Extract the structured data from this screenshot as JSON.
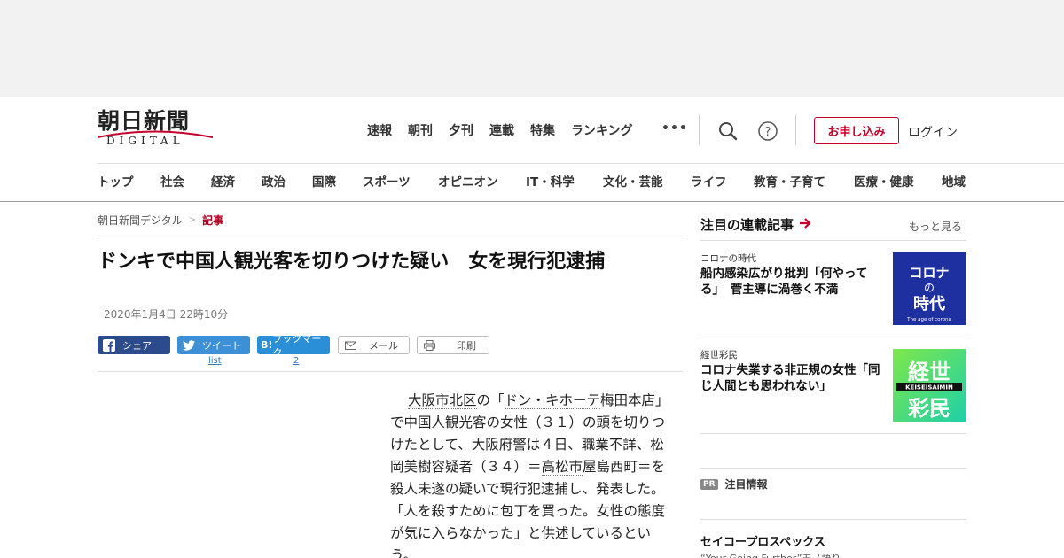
{
  "header": {
    "logo_main": "朝日新聞",
    "logo_sub": "DIGITAL",
    "top_nav": [
      "速報",
      "朝刊",
      "夕刊",
      "連載",
      "特集",
      "ランキング"
    ],
    "more": "•••",
    "subscribe": "お申し込み",
    "login": "ログイン"
  },
  "category_nav": [
    "トップ",
    "社会",
    "経済",
    "政治",
    "国際",
    "スポーツ",
    "オピニオン",
    "IT・科学",
    "文化・芸能",
    "ライフ",
    "教育・子育て",
    "医療・健康",
    "地域"
  ],
  "breadcrumb": {
    "root": "朝日新聞デジタル",
    "sep": ">",
    "current": "記事"
  },
  "article": {
    "headline": "ドンキで中国人観光客を切りつけた疑い　女を現行犯逮捕",
    "date": "2020年1月4日 22時10分",
    "share": {
      "facebook": "シェア",
      "twitter": "ツイート",
      "hatena_icon": "B!",
      "hatena": "ブックマーク",
      "mail": "メール",
      "print": "印刷",
      "twitter_count": "list",
      "hatena_count": "2"
    },
    "body": {
      "p1": "大阪市北区",
      "p2": "の「",
      "p3": "ドン・キホーテ",
      "p4": "梅田本店」で中国人観光客の女性（３１）の頭を切りつけたとして、",
      "p5": "大阪府警",
      "p6": "は４日、職業不詳、松岡美樹容疑者（３４）＝",
      "p7": "高松市",
      "p8": "屋島西町＝を殺人未遂の疑いで現行犯逮捕し、発表した。「人を殺すために包丁を買った。女性の態度が気に入らなかった」と供述しているという。"
    }
  },
  "rail": {
    "title": "注目の連載記事",
    "more": "もっと見る",
    "cards": [
      {
        "category": "コロナの時代",
        "title": "船内感染広がり批判「何やってる」　菅主導に渦巻く不満",
        "thumb_text": "コロナの時代",
        "thumb_sub": "The age of corona"
      },
      {
        "category": "経世彩民",
        "title": "コロナ失業する非正規の女性「同じ人間とも思われない」",
        "thumb_text_1": "経世",
        "thumb_text_2": "彩民",
        "thumb_sub": "KEISEISAIMIN"
      }
    ],
    "pr_badge": "PR",
    "pr_label": "注目情報",
    "sponsor": "セイコープロスペックス",
    "sponsor_sub": "“Your Going Further”モノ語り"
  },
  "colors": {
    "accent_red": "#c4002a",
    "facebook": "#2c4b8c",
    "twitter": "#3d8fd6",
    "hatena": "#2a8fd6",
    "link": "#2a7ac2"
  }
}
